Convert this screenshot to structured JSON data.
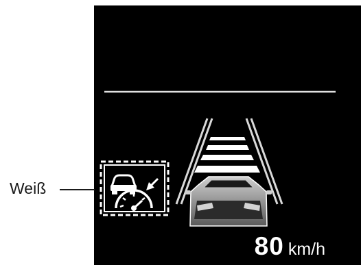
{
  "callout": {
    "label": "Weiß"
  },
  "speed": {
    "value": "80",
    "unit": "km/h"
  },
  "indicator": {
    "color": "#ffffff",
    "icon": "adaptive-cruise-control-icon",
    "style": "dashed-border"
  },
  "colors": {
    "display_bg": "#000000",
    "lines": "#d9d9d9",
    "symbol": "#ffffff"
  }
}
